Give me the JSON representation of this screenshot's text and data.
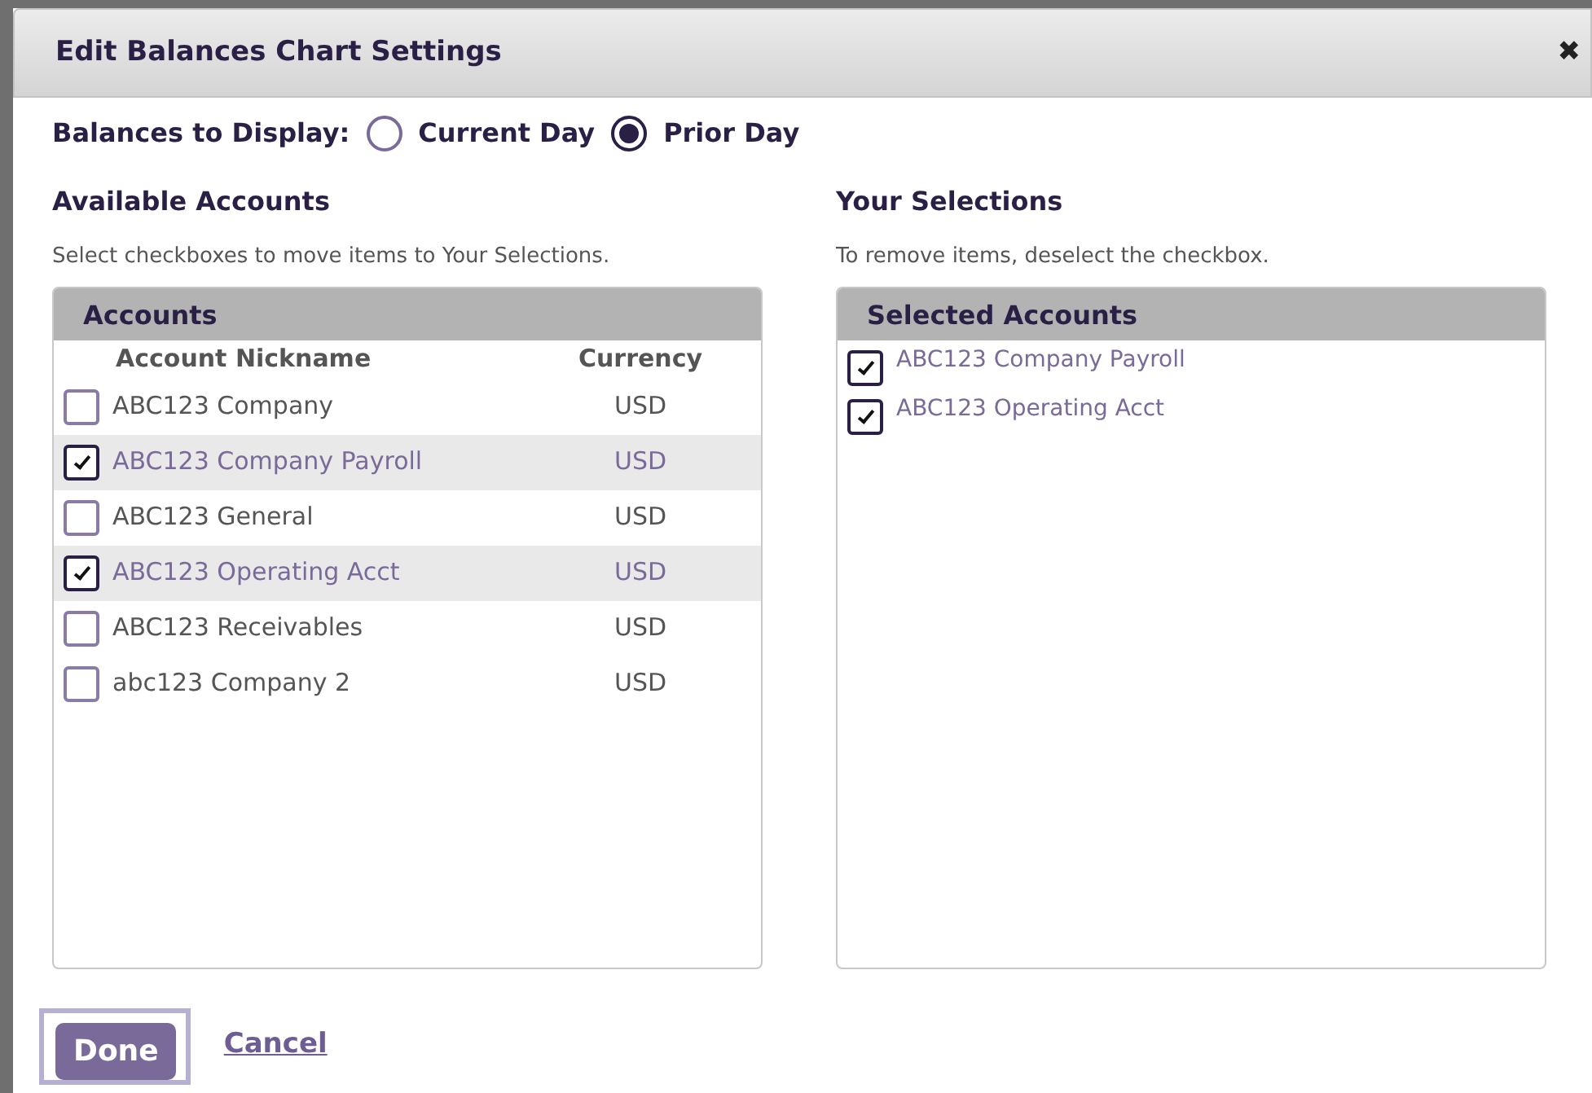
{
  "dialog": {
    "title": "Edit Balances Chart Settings",
    "close": "✖"
  },
  "balances_to_display": {
    "label": "Balances to Display:",
    "options": [
      {
        "label": "Current Day",
        "selected": false
      },
      {
        "label": "Prior Day",
        "selected": true
      }
    ]
  },
  "available": {
    "heading": "Available Accounts",
    "hint": "Select checkboxes to move items to Your Selections.",
    "panel_title": "Accounts",
    "columns": [
      "Account Nickname",
      "Currency"
    ],
    "rows": [
      {
        "nickname": "ABC123 Company",
        "currency": "USD",
        "checked": false
      },
      {
        "nickname": "ABC123 Company Payroll",
        "currency": "USD",
        "checked": true
      },
      {
        "nickname": "ABC123 General",
        "currency": "USD",
        "checked": false
      },
      {
        "nickname": "ABC123 Operating Acct",
        "currency": "USD",
        "checked": true
      },
      {
        "nickname": "ABC123 Receivables",
        "currency": "USD",
        "checked": false
      },
      {
        "nickname": "abc123 Company 2",
        "currency": "USD",
        "checked": false
      }
    ]
  },
  "selections": {
    "heading": "Your Selections",
    "hint": "To remove items, deselect the checkbox.",
    "panel_title": "Selected Accounts",
    "items": [
      {
        "label": "ABC123 Company Payroll",
        "checked": true
      },
      {
        "label": "ABC123 Operating Acct",
        "checked": true
      }
    ]
  },
  "buttons": {
    "done": "Done",
    "cancel": "Cancel"
  }
}
